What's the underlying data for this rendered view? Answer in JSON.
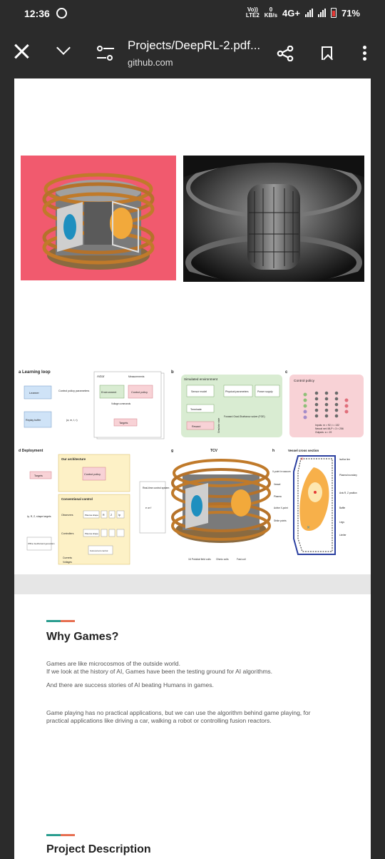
{
  "status": {
    "time": "12:36",
    "volte_line1": "Vo)) ",
    "volte_line2": "LTE2",
    "speed_line1": "0",
    "speed_line2": "KB/s",
    "network": "4G+",
    "battery": "71%"
  },
  "appbar": {
    "title": "Projects/DeepRL-2.pdf...",
    "subtitle": "github.com"
  },
  "figure": {
    "panel_a": "a Learning loop",
    "actor": "Actor",
    "measurements": "Measurements",
    "learner": "Learner",
    "control_policy_parameters": "Control policy parameters",
    "environment": "Environment",
    "control_policy": "Control policy",
    "voltage_commands": "Voltage commands",
    "replay_buffer": "Replay buffer",
    "tuple": "(a, m, t, r)",
    "targets": "Targets",
    "panel_b": "b",
    "simulated_environment": "Simulated environment",
    "sensor_model": "Sensor model",
    "physical_parameters": "Physical parameters",
    "power_supply": "Power supply",
    "terminate": "Terminate",
    "forward_solver": "Forward Grad-Shafranov solver (FGE)",
    "reward": "Reward",
    "simulator_state": "Simulator state",
    "panel_c": "c",
    "control_policy_title": "Control policy",
    "inputs": "Inputs: m = 92, t = 132",
    "neural_net": "Neural net: MLP = 3 × 256",
    "outputs": "Outputs: a = 19",
    "panel_d": "d Deployment",
    "our_architecture": "Our architecture",
    "conventional_control": "Conventional control",
    "control_policy_d": "Control policy",
    "targets_d": "Targets",
    "ip_shape_targets": "Ip, R, Z, shape targets",
    "observers": "Observers",
    "plasma_shape": "Plasma shape",
    "controllers": "Controllers",
    "offline_ff": "Offline feedforward generation",
    "coil_current_control": "Coil-current control",
    "currents": "Currents",
    "voltages": "Voltages",
    "r": "R",
    "z": "Z",
    "ip": "Ip",
    "realtime": "Real-time control system",
    "e_or_f": "e or f",
    "panel_g": "g",
    "tcv": "TCV",
    "poloidal_coils": "16 Poloidal field coils",
    "ohmic_coils": "Ohmic coils",
    "fast_coil": "Fast coil",
    "panel_h": "h",
    "vessel_cross_section": "Vessel cross section",
    "xpoint_vacuum": "X-point in vacuum",
    "vessel": "Vessel",
    "plasma": "Plasma",
    "active_xpoint": "Active X-point",
    "strike_points": "Strike points",
    "isoflux": "Isoflux line",
    "plasma_boundary": "Plasma boundary",
    "axis": "Axis R, Z position",
    "baffle": "Baffle",
    "legs": "Legs",
    "limiter": "Limiter"
  },
  "article": {
    "heading1": "Why Games?",
    "p1_line1": "Games are like microcosmos of the outside world.",
    "p1_line2": "If we look at the history of AI, Games have been the testing ground for AI algorithms.",
    "p2": "And there are success stories of AI beating Humans in games.",
    "p3_line1": "Game playing has no practical applications, but we can use the algorithm behind game playing, for",
    "p3_line2": "practical applications like driving a car, walking a robot or controlling fusion reactors.",
    "heading2": "Project Description"
  },
  "colors": {
    "bar_bg": "#2b2b2b",
    "pink_panel": "#f15a6e",
    "green_box": "#d9ecd2",
    "pink_box": "#f8d2d6",
    "yellow_box": "#fdf1c6",
    "accent_teal": "#2a9d8f",
    "accent_orange": "#e76f51"
  }
}
